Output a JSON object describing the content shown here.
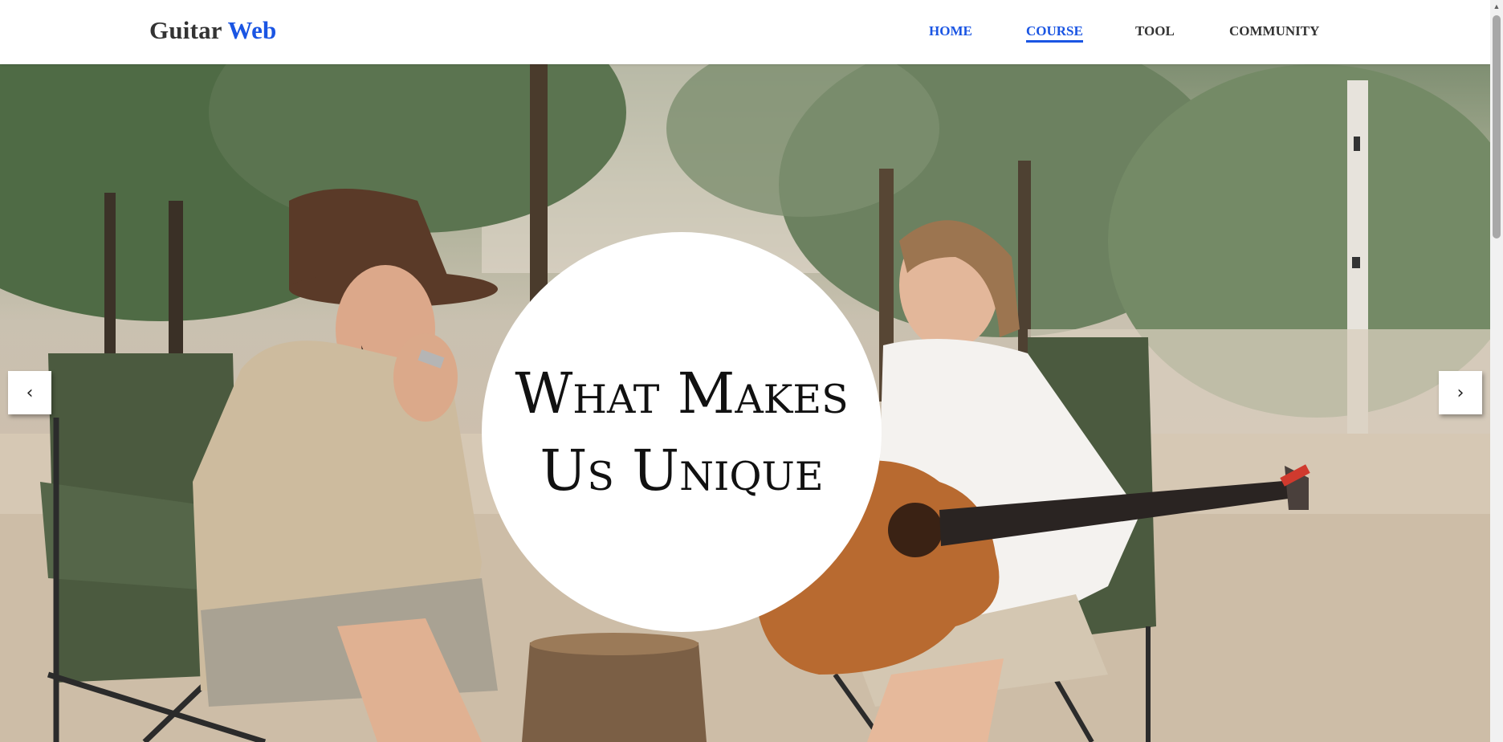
{
  "header": {
    "logo_main": "Guitar",
    "logo_accent": "Web",
    "nav": [
      {
        "label": "HOME"
      },
      {
        "label": "COURSE"
      },
      {
        "label": "TOOL"
      },
      {
        "label": "COMMUNITY"
      }
    ]
  },
  "hero": {
    "title": "What Makes\nUs Unique",
    "photo_description_icon": "photo-couple-playing-music",
    "prev_label": "‹",
    "next_label": "›"
  },
  "colors": {
    "accent": "#1a55e3",
    "text": "#333333"
  }
}
